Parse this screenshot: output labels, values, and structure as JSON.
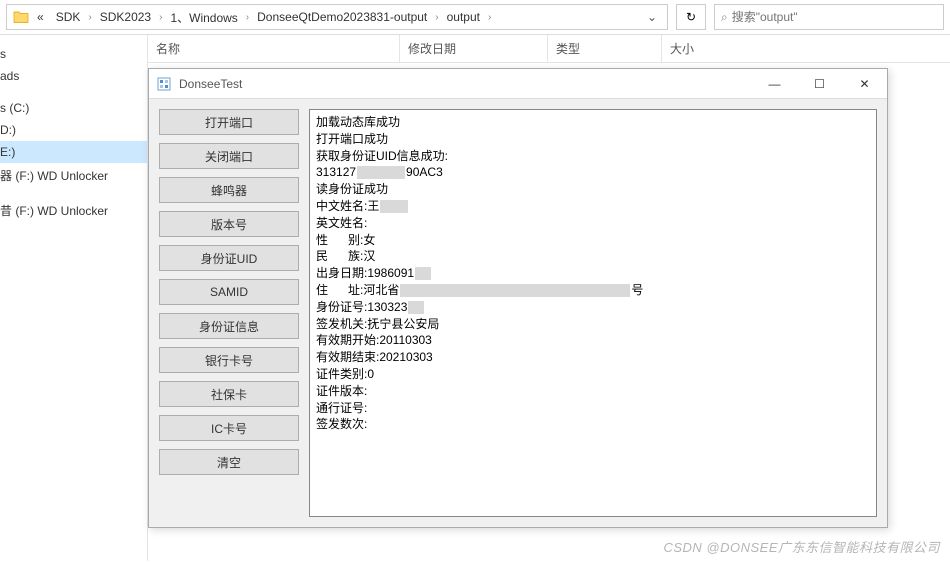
{
  "breadcrumb": {
    "prefix": "«",
    "segments": [
      "SDK",
      "SDK2023",
      "1、Windows",
      "DonseeQtDemo2023831-output",
      "output"
    ]
  },
  "refresh_icon": "↻",
  "search": {
    "icon": "🔍",
    "placeholder": "搜索\"output\""
  },
  "sidebar": {
    "items": [
      {
        "label": "s",
        "selected": false
      },
      {
        "label": "ads",
        "selected": false
      },
      {
        "label": "",
        "spacer": true
      },
      {
        "label": "s (C:)",
        "selected": false
      },
      {
        "label": "D:)",
        "selected": false
      },
      {
        "label": "E:)",
        "selected": true
      },
      {
        "label": "器 (F:) WD Unlocker",
        "selected": false
      },
      {
        "label": "",
        "spacer": true
      },
      {
        "label": "昔 (F:) WD Unlocker",
        "selected": false
      }
    ]
  },
  "columns": {
    "name": "名称",
    "modified": "修改日期",
    "type": "类型",
    "size": "大小"
  },
  "app": {
    "title": "DonseeTest",
    "buttons": [
      "打开端口",
      "关闭端口",
      "蜂鸣器",
      "版本号",
      "身份证UID",
      "SAMID",
      "身份证信息",
      "银行卡号",
      "社保卡",
      "IC卡号",
      "清空"
    ],
    "output": [
      {
        "text": "加载动态库成功"
      },
      {
        "text": "打开端口成功"
      },
      {
        "text": "获取身份证UID信息成功:"
      },
      {
        "text": "313127",
        "redact": 48,
        "suffix": "90AC3"
      },
      {
        "text": "读身份证成功"
      },
      {
        "text": "中文姓名:王",
        "redact": 28
      },
      {
        "text": "英文姓名:"
      },
      {
        "text": "性      别:女"
      },
      {
        "text": "民      族:汉"
      },
      {
        "text": "出身日期:1986091",
        "redact": 16
      },
      {
        "text": "住      址:河北省",
        "redact": 230,
        "suffix": "号"
      },
      {
        "text": "身份证号:130323",
        "redact": 16
      },
      {
        "text": "签发机关:抚宁县公安局"
      },
      {
        "text": "有效期开始:20110303"
      },
      {
        "text": "有效期结束:20210303"
      },
      {
        "text": "证件类别:0"
      },
      {
        "text": "证件版本:"
      },
      {
        "text": "通行证号:"
      },
      {
        "text": "签发数次:"
      }
    ]
  },
  "window_controls": {
    "minimize": "—",
    "maximize": "☐",
    "close": "✕"
  },
  "watermark": "CSDN @DONSEE广东东信智能科技有限公司"
}
